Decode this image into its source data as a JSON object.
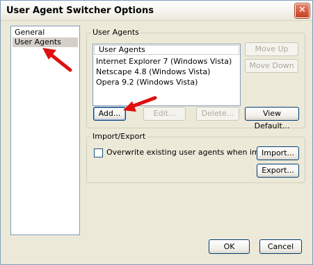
{
  "window": {
    "title": "User Agent Switcher Options",
    "close_glyph": "✕"
  },
  "nav": {
    "items": [
      {
        "label": "General",
        "selected": false
      },
      {
        "label": "User Agents",
        "selected": true
      }
    ]
  },
  "user_agents": {
    "group_label": "User Agents",
    "list_header": "User Agents",
    "items": [
      "Internet Explorer 7 (Windows Vista)",
      "Netscape 4.8 (Windows Vista)",
      "Opera 9.2 (Windows Vista)"
    ],
    "buttons": {
      "move_up": "Move Up",
      "move_down": "Move Down",
      "add": "Add...",
      "edit": "Edit...",
      "delete": "Delete...",
      "view_default": "View Default..."
    }
  },
  "import_export": {
    "group_label": "Import/Export",
    "overwrite_label": "Overwrite existing user agents when importing",
    "overwrite_checked": false,
    "buttons": {
      "import": "Import...",
      "export": "Export..."
    }
  },
  "footer": {
    "ok": "OK",
    "cancel": "Cancel"
  },
  "colors": {
    "annotation_arrow": "#e01010",
    "dialog_background": "#ece9d8",
    "selected_nav_background": "#d4d0c8"
  }
}
